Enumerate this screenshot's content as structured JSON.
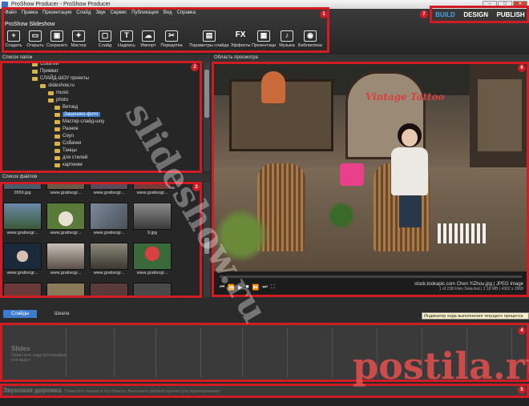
{
  "window": {
    "title": "ProShow Producer - ProShow Producer",
    "buttons": [
      "–",
      "□",
      "✕"
    ]
  },
  "menu": [
    "Файл",
    "Правка",
    "Презентация",
    "Слайд",
    "Звук",
    "Сервис",
    "Публикация",
    "Вид",
    "Справка"
  ],
  "project_title": "ProShow Slideshow",
  "toolbar": [
    {
      "label": "Создать",
      "icon": "new-icon",
      "glyph": "+"
    },
    {
      "label": "Открыть",
      "icon": "open-folder-icon",
      "glyph": "▭"
    },
    {
      "label": "Сохранить",
      "icon": "save-icon",
      "glyph": "▣"
    },
    {
      "label": "Мастер",
      "icon": "wizard-icon",
      "glyph": "✦"
    },
    {
      "label": "Слайд",
      "icon": "slide-icon",
      "glyph": "▢"
    },
    {
      "label": "Надпись",
      "icon": "caption-icon",
      "glyph": "T"
    },
    {
      "label": "Импорт",
      "icon": "import-icon",
      "glyph": "☁"
    },
    {
      "label": "Передотка",
      "icon": "tools-icon",
      "glyph": "✂"
    },
    {
      "label": "Параметры слайда",
      "icon": "slide-options-icon",
      "glyph": "▤"
    },
    {
      "label": "Эффекты",
      "icon": "fx-icon",
      "glyph": "FX"
    },
    {
      "label": "Презентация",
      "icon": "show-icon",
      "glyph": "▦"
    },
    {
      "label": "Музыка",
      "icon": "music-icon",
      "glyph": "♪"
    },
    {
      "label": "Библиотека",
      "icon": "library-icon",
      "glyph": "◉"
    }
  ],
  "modes": {
    "build": "BUILD",
    "design": "DESIGN",
    "publish": "PUBLISH"
  },
  "badges": [
    "1",
    "2",
    "3",
    "4",
    "5",
    "6",
    "7"
  ],
  "folders": {
    "header": "Список папок",
    "items": [
      {
        "label": "Сокатии",
        "depth": 2
      },
      {
        "label": "Привват",
        "depth": 2
      },
      {
        "label": "СЛАЙД-ШОУ проекты",
        "depth": 2
      },
      {
        "label": "slideshow.ru",
        "depth": 3
      },
      {
        "label": "music",
        "depth": 4
      },
      {
        "label": "photo",
        "depth": 4
      },
      {
        "label": "Ветокд",
        "depth": 5
      },
      {
        "label": "Зацензео-фото",
        "depth": 5,
        "selected": true
      },
      {
        "label": "Мастер слайд-шоу",
        "depth": 5
      },
      {
        "label": "Разное",
        "depth": 5
      },
      {
        "label": "Сеул",
        "depth": 5
      },
      {
        "label": "Собачки",
        "depth": 5
      },
      {
        "label": "Танцы",
        "depth": 5
      },
      {
        "label": "для стилей",
        "depth": 5
      },
      {
        "label": "картинки",
        "depth": 5
      }
    ]
  },
  "files": {
    "header": "Список файлов",
    "rows": [
      [
        "2659.jpg",
        "www.gratisogr...",
        "www.gratisogr...",
        "www.gratisogr..."
      ],
      [
        "www.gratisogr...",
        "www.gratisogr...",
        "www.gratisogr...",
        "9.jpg"
      ],
      [
        "www.gratisogr...",
        "www.gratisogr...",
        "www.gratisogr...",
        "www.gratisogr..."
      ]
    ]
  },
  "preview": {
    "header": "Область просмотра",
    "controls": [
      "⏮",
      "⏪",
      "▶",
      "■",
      "⏩",
      "⏭",
      "⛶"
    ],
    "file_info": "stock.tookapic.com Chen YiZhou.jpg  |  JPEG Image",
    "file_sub": "1 of 238 Files Selected  |  2.18 MB  |  4302 x 2868",
    "sign_text": "Vintage Tattoo"
  },
  "tabs": {
    "slides": "Слайды",
    "timeline": "Шкала"
  },
  "tooltip": "Индикатор хода выполнения текущего процесса",
  "timeline": {
    "title": "Slides",
    "hint": "Поместите сюда фотографии или видео"
  },
  "audio": {
    "title": "Звуковая дорожка",
    "hint": "Поместите музыку в эту область. Выполните двойной щелчок для редактирования."
  },
  "watermarks": {
    "left": "slideshow.ru",
    "right": "postila.ru"
  }
}
